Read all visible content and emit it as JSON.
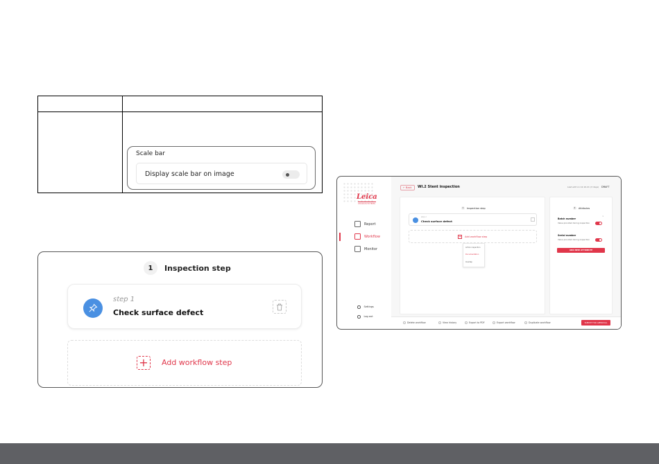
{
  "scale_bar": {
    "title": "Scale bar",
    "row_label": "Display scale bar on image",
    "toggle_state": "off"
  },
  "zoom_card": {
    "step_number": "1",
    "title": "Inspection step",
    "step_subtitle": "step 1",
    "step_name": "Check surface defect",
    "add_label": "Add workflow step"
  },
  "app": {
    "logo": "Leica",
    "logo_sub": "MICROSYSTEMS",
    "sidebar": [
      "Report",
      "Workflow",
      "Monitor"
    ],
    "active_item": "Workflow",
    "footer_links": [
      "Settings",
      "Log out"
    ],
    "back_label": "← Back",
    "title": "WI.2 Stent inspection",
    "meta": "Last edit on 12.10.21 (3 days)",
    "status": "DRAFT",
    "steps_panel": {
      "number": "1",
      "title": "Inspection step",
      "step_sub": "step 1",
      "step_name": "Check surface defect",
      "add_label": "Add workflow step",
      "dropdown": [
        "Action inspection",
        "Documentation",
        "Overlap"
      ]
    },
    "attributes_panel": {
      "number": "2",
      "title": "Attributes",
      "attributes": [
        {
          "name": "Batch number",
          "desc": "Value provided during inspection"
        },
        {
          "name": "Serial number",
          "desc": "Value provided during inspection"
        }
      ],
      "add_button": "ADD NEW ATTRIBUTE"
    },
    "footer_actions": [
      "Delete workflow",
      "View history",
      "Export to PDF",
      "Export workflow",
      "Duplicate workflow"
    ],
    "submit_label": "SUBMIT FOR APPROVAL"
  },
  "colors": {
    "accent": "#e0364a",
    "pin": "#4a90e2",
    "bottom_bar": "#5f6064"
  }
}
